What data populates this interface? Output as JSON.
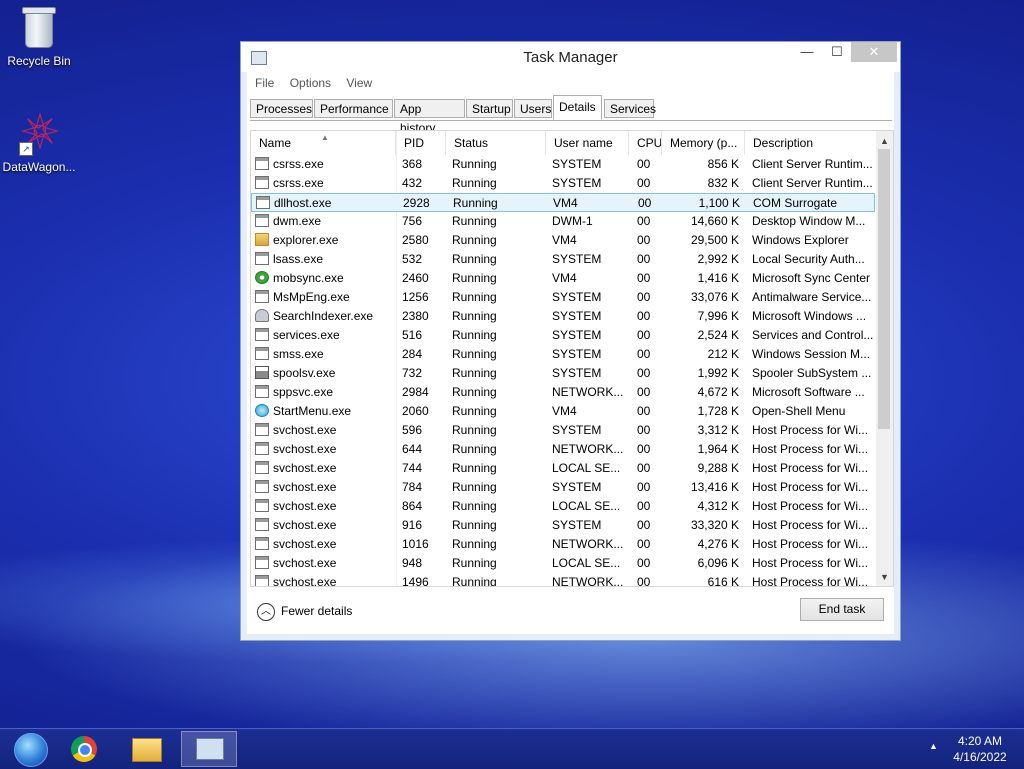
{
  "desktop": {
    "icons": [
      {
        "label": "Recycle Bin",
        "icon": "recycle-bin-icon"
      },
      {
        "label": "DataWagon...",
        "icon": "datawagon-icon"
      }
    ]
  },
  "window": {
    "title": "Task Manager",
    "controls": {
      "minimize": "—",
      "maximize": "☐",
      "close": "✕"
    },
    "menu": [
      "File",
      "Options",
      "View"
    ],
    "tabs": [
      "Processes",
      "Performance",
      "App history",
      "Startup",
      "Users",
      "Details",
      "Services"
    ],
    "active_tab": "Details",
    "columns": [
      "Name",
      "PID",
      "Status",
      "User name",
      "CPU",
      "Memory (p...",
      "Description"
    ],
    "rows": [
      {
        "name": "csrss.exe",
        "pid": "368",
        "status": "Running",
        "user": "SYSTEM",
        "cpu": "00",
        "mem": "856 K",
        "desc": "Client Server Runtim..."
      },
      {
        "name": "csrss.exe",
        "pid": "432",
        "status": "Running",
        "user": "SYSTEM",
        "cpu": "00",
        "mem": "832 K",
        "desc": "Client Server Runtim..."
      },
      {
        "name": "dllhost.exe",
        "pid": "2928",
        "status": "Running",
        "user": "VM4",
        "cpu": "00",
        "mem": "1,100 K",
        "desc": "COM Surrogate"
      },
      {
        "name": "dwm.exe",
        "pid": "756",
        "status": "Running",
        "user": "DWM-1",
        "cpu": "00",
        "mem": "14,660 K",
        "desc": "Desktop Window M..."
      },
      {
        "name": "explorer.exe",
        "pid": "2580",
        "status": "Running",
        "user": "VM4",
        "cpu": "00",
        "mem": "29,500 K",
        "desc": "Windows Explorer"
      },
      {
        "name": "lsass.exe",
        "pid": "532",
        "status": "Running",
        "user": "SYSTEM",
        "cpu": "00",
        "mem": "2,992 K",
        "desc": "Local Security Auth..."
      },
      {
        "name": "mobsync.exe",
        "pid": "2460",
        "status": "Running",
        "user": "VM4",
        "cpu": "00",
        "mem": "1,416 K",
        "desc": "Microsoft Sync Center"
      },
      {
        "name": "MsMpEng.exe",
        "pid": "1256",
        "status": "Running",
        "user": "SYSTEM",
        "cpu": "00",
        "mem": "33,076 K",
        "desc": "Antimalware Service..."
      },
      {
        "name": "SearchIndexer.exe",
        "pid": "2380",
        "status": "Running",
        "user": "SYSTEM",
        "cpu": "00",
        "mem": "7,996 K",
        "desc": "Microsoft Windows ..."
      },
      {
        "name": "services.exe",
        "pid": "516",
        "status": "Running",
        "user": "SYSTEM",
        "cpu": "00",
        "mem": "2,524 K",
        "desc": "Services and Control..."
      },
      {
        "name": "smss.exe",
        "pid": "284",
        "status": "Running",
        "user": "SYSTEM",
        "cpu": "00",
        "mem": "212 K",
        "desc": "Windows Session M..."
      },
      {
        "name": "spoolsv.exe",
        "pid": "732",
        "status": "Running",
        "user": "SYSTEM",
        "cpu": "00",
        "mem": "1,992 K",
        "desc": "Spooler SubSystem ..."
      },
      {
        "name": "sppsvc.exe",
        "pid": "2984",
        "status": "Running",
        "user": "NETWORK...",
        "cpu": "00",
        "mem": "4,672 K",
        "desc": "Microsoft Software ..."
      },
      {
        "name": "StartMenu.exe",
        "pid": "2060",
        "status": "Running",
        "user": "VM4",
        "cpu": "00",
        "mem": "1,728 K",
        "desc": "Open-Shell Menu"
      },
      {
        "name": "svchost.exe",
        "pid": "596",
        "status": "Running",
        "user": "SYSTEM",
        "cpu": "00",
        "mem": "3,312 K",
        "desc": "Host Process for Wi..."
      },
      {
        "name": "svchost.exe",
        "pid": "644",
        "status": "Running",
        "user": "NETWORK...",
        "cpu": "00",
        "mem": "1,964 K",
        "desc": "Host Process for Wi..."
      },
      {
        "name": "svchost.exe",
        "pid": "744",
        "status": "Running",
        "user": "LOCAL SE...",
        "cpu": "00",
        "mem": "9,288 K",
        "desc": "Host Process for Wi..."
      },
      {
        "name": "svchost.exe",
        "pid": "784",
        "status": "Running",
        "user": "SYSTEM",
        "cpu": "00",
        "mem": "13,416 K",
        "desc": "Host Process for Wi..."
      },
      {
        "name": "svchost.exe",
        "pid": "864",
        "status": "Running",
        "user": "LOCAL SE...",
        "cpu": "00",
        "mem": "4,312 K",
        "desc": "Host Process for Wi..."
      },
      {
        "name": "svchost.exe",
        "pid": "916",
        "status": "Running",
        "user": "SYSTEM",
        "cpu": "00",
        "mem": "33,320 K",
        "desc": "Host Process for Wi..."
      },
      {
        "name": "svchost.exe",
        "pid": "1016",
        "status": "Running",
        "user": "NETWORK...",
        "cpu": "00",
        "mem": "4,276 K",
        "desc": "Host Process for Wi..."
      },
      {
        "name": "svchost.exe",
        "pid": "948",
        "status": "Running",
        "user": "LOCAL SE...",
        "cpu": "00",
        "mem": "6,096 K",
        "desc": "Host Process for Wi..."
      },
      {
        "name": "svchost.exe",
        "pid": "1496",
        "status": "Running",
        "user": "NETWORK...",
        "cpu": "00",
        "mem": "616 K",
        "desc": "Host Process for Wi..."
      }
    ],
    "selected_row": 2,
    "fewer_details": "Fewer details",
    "end_task": "End task"
  },
  "taskbar": {
    "items": [
      "start-orb-icon",
      "chrome-icon",
      "file-explorer-icon",
      "task-manager-icon"
    ],
    "clock_time": "4:20 AM",
    "clock_date": "4/16/2022"
  }
}
